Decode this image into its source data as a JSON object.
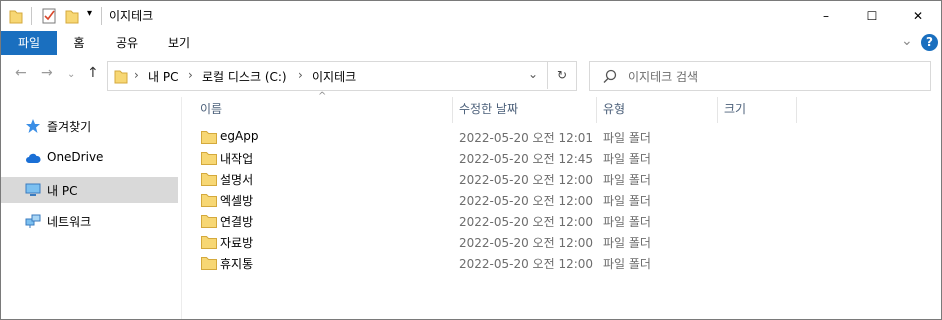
{
  "window": {
    "title": "이지테크",
    "minimize": "–",
    "maximize": "☐",
    "close": "✕"
  },
  "ribbon": {
    "tabs": [
      "파일",
      "홈",
      "공유",
      "보기"
    ],
    "expand": "⌄",
    "help": "?"
  },
  "address": {
    "segments": [
      "내 PC",
      "로컬 디스크 (C:)",
      "이지테크"
    ],
    "search_placeholder": "이지테크 검색"
  },
  "nav_pane": {
    "items": [
      {
        "label": "즐겨찾기",
        "icon": "star-icon"
      },
      {
        "label": "OneDrive",
        "icon": "cloud-icon"
      },
      {
        "label": "내 PC",
        "icon": "computer-icon",
        "selected": true
      },
      {
        "label": "네트워크",
        "icon": "network-icon"
      }
    ]
  },
  "columns": [
    "이름",
    "수정한 날짜",
    "유형",
    "크기"
  ],
  "files": [
    {
      "name": "egApp",
      "modified": "2022-05-20 오전 12:01",
      "type": "파일 폴더"
    },
    {
      "name": "내작업",
      "modified": "2022-05-20 오전 12:45",
      "type": "파일 폴더"
    },
    {
      "name": "설명서",
      "modified": "2022-05-20 오전 12:00",
      "type": "파일 폴더"
    },
    {
      "name": "엑셀방",
      "modified": "2022-05-20 오전 12:00",
      "type": "파일 폴더"
    },
    {
      "name": "연결방",
      "modified": "2022-05-20 오전 12:00",
      "type": "파일 폴더"
    },
    {
      "name": "자료방",
      "modified": "2022-05-20 오전 12:00",
      "type": "파일 폴더"
    },
    {
      "name": "휴지통",
      "modified": "2022-05-20 오전 12:00",
      "type": "파일 폴더"
    }
  ],
  "colors": {
    "accent": "#1a6fbf",
    "folder": "#f7d774",
    "selected": "#d9d9d9",
    "header_text": "#4c607a"
  }
}
